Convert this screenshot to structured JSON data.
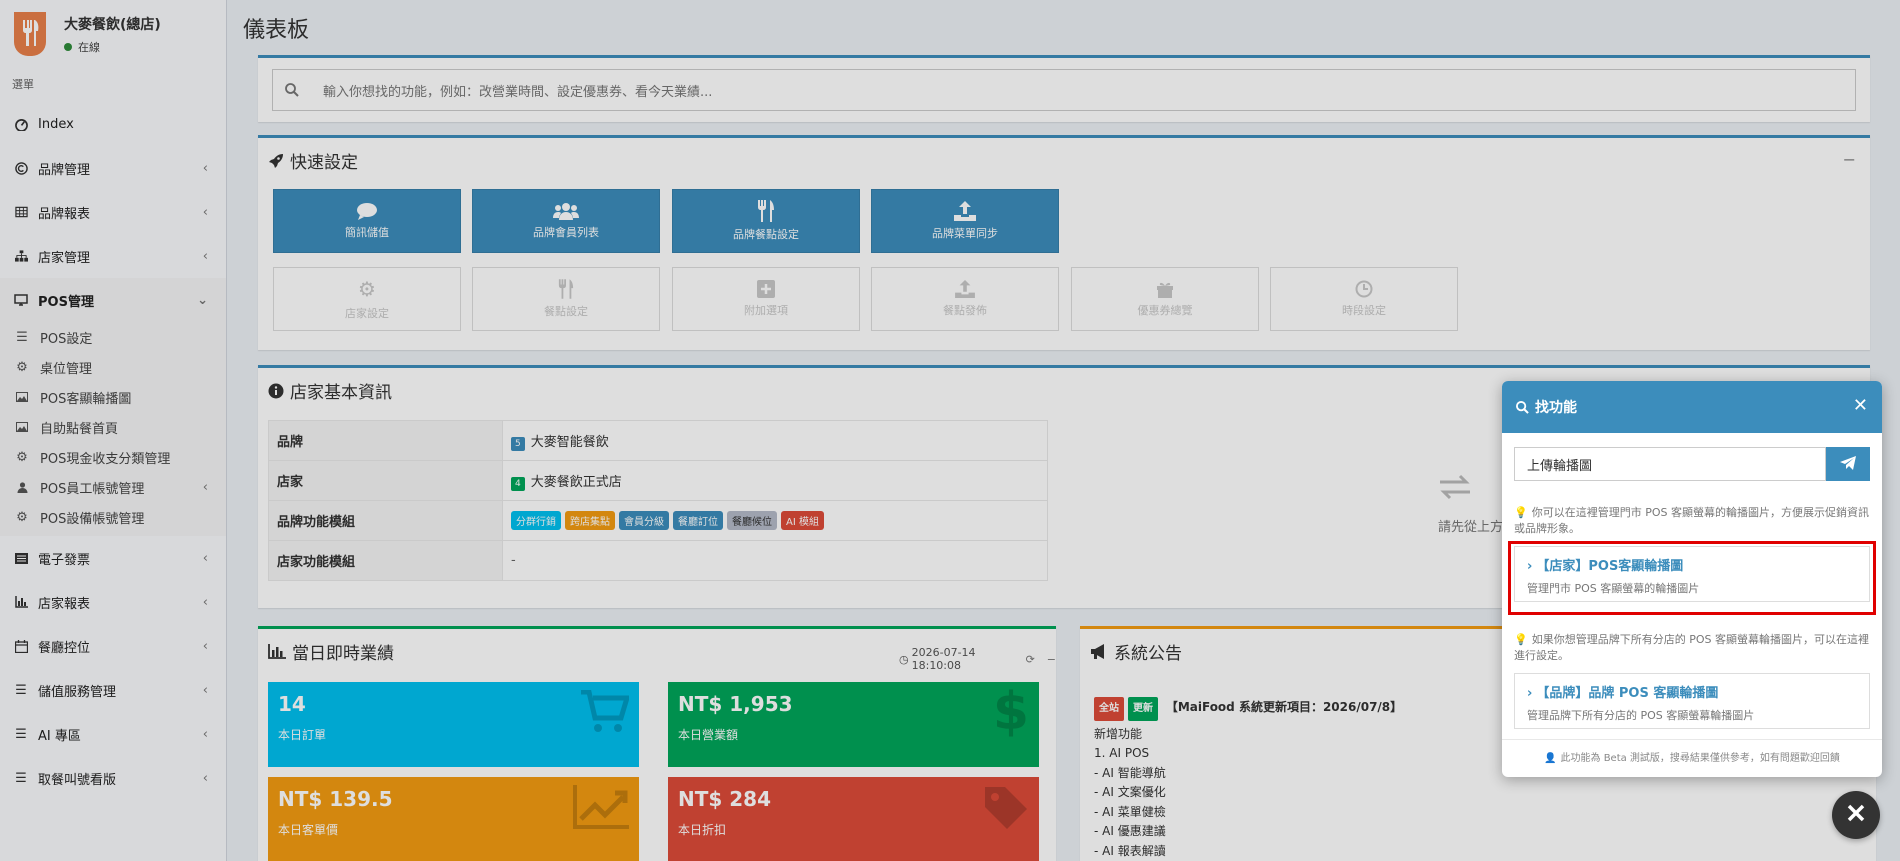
{
  "brand": {
    "name": "大麥餐飲(總店)",
    "status": "在線"
  },
  "sidebar": {
    "heading": "選單",
    "items": [
      {
        "label": "Index",
        "icon": "dashboard-icon"
      },
      {
        "label": "品牌管理",
        "icon": "copyright-icon"
      },
      {
        "label": "品牌報表",
        "icon": "table-icon"
      },
      {
        "label": "店家管理",
        "icon": "sitemap-icon"
      },
      {
        "label": "POS管理",
        "icon": "desktop-icon"
      },
      {
        "label": "電子發票",
        "icon": "list-icon"
      },
      {
        "label": "店家報表",
        "icon": "bar-chart-icon"
      },
      {
        "label": "餐廳控位",
        "icon": "calendar-icon"
      },
      {
        "label": "儲值服務管理",
        "icon": "bars-icon"
      },
      {
        "label": "AI 專區",
        "icon": "bars-icon"
      },
      {
        "label": "取餐叫號看版",
        "icon": "bars-icon"
      }
    ],
    "pos_sub": [
      {
        "label": "POS設定",
        "icon": "bars-icon"
      },
      {
        "label": "桌位管理",
        "icon": "gear-icon"
      },
      {
        "label": "POS客顯輪播圖",
        "icon": "image-icon"
      },
      {
        "label": "自助點餐首頁",
        "icon": "image-icon"
      },
      {
        "label": "POS現金收支分類管理",
        "icon": "gear-icon"
      },
      {
        "label": "POS員工帳號管理",
        "icon": "user-icon"
      },
      {
        "label": "POS設備帳號管理",
        "icon": "gear-icon"
      }
    ]
  },
  "page": {
    "title": "儀表板",
    "search_placeholder": "輸入你想找的功能，例如：改營業時間、設定優惠券、看今天業績..."
  },
  "quick": {
    "title": "快速設定",
    "collapse": "−",
    "active": [
      "簡訊儲值",
      "品牌會員列表",
      "品牌餐點設定",
      "品牌菜單同步"
    ],
    "disabled": [
      "店家設定",
      "餐點設定",
      "附加選項",
      "餐點發佈",
      "優惠券總覽",
      "時段設定"
    ]
  },
  "store_info": {
    "title": "店家基本資訊",
    "rows": [
      {
        "key": "品牌",
        "badge": "5",
        "value": "大麥智能餐飲"
      },
      {
        "key": "店家",
        "badge": "4",
        "value": "大麥餐飲正式店"
      },
      {
        "key": "品牌功能模組"
      },
      {
        "key": "店家功能模組",
        "value": "-"
      }
    ],
    "modules": [
      {
        "label": "分群行銷",
        "color": "#00c0ef"
      },
      {
        "label": "跨店集點",
        "color": "#f39c12"
      },
      {
        "label": "會員分級",
        "color": "#3c8dbc"
      },
      {
        "label": "餐廳訂位",
        "color": "#3c8dbc"
      },
      {
        "label": "餐廳候位",
        "color": "#b5bbc8"
      },
      {
        "label": "AI 模組",
        "color": "#dd4b39"
      }
    ],
    "side_hint": "請先從上方選擇"
  },
  "realtime": {
    "title": "當日即時業績",
    "timestamp": "2026-07-14 18:10:08",
    "stats": [
      {
        "value": "14",
        "label": "本日訂單",
        "color": "#00c0ef"
      },
      {
        "value": "NT$ 1,953",
        "label": "本日營業額",
        "color": "#00a65a"
      },
      {
        "value": "NT$ 139.5",
        "label": "本日客單價",
        "color": "#f39c12"
      },
      {
        "value": "NT$ 284",
        "label": "本日折扣",
        "color": "#dd4b39"
      }
    ]
  },
  "announce": {
    "title": "系統公告",
    "tag1": "全站",
    "tag2": "更新",
    "headline": "【MaiFood 系統更新項目：2026/07/8】",
    "lines": [
      "新增功能",
      "1. AI POS",
      "- AI 智能導航",
      "- AI 文案優化",
      "- AI 菜單健檢",
      "- AI 優惠建議",
      "- AI 報表解讀"
    ]
  },
  "finder": {
    "title": "找功能",
    "query": "上傳輪播圖",
    "hint1": "你可以在這裡管理門市 POS 客顯螢幕的輪播圖片，方便展示促銷資訊或品牌形象。",
    "result1_title": "【店家】POS客顯輪播圖",
    "result1_desc": "管理門市 POS 客顯螢幕的輪播圖片",
    "hint2": "如果你想管理品牌下所有分店的 POS 客顯螢幕輪播圖片，可以在這裡進行設定。",
    "result2_title": "【品牌】品牌 POS 客顯輪播圖",
    "result2_desc": "管理品牌下所有分店的 POS 客顯螢幕輪播圖片",
    "footer": "此功能為 Beta 測試版，搜尋結果僅供參考，如有問題歡迎回饋"
  },
  "colors": {
    "primary": "#3c8dbc",
    "highlight": "#e00000"
  }
}
